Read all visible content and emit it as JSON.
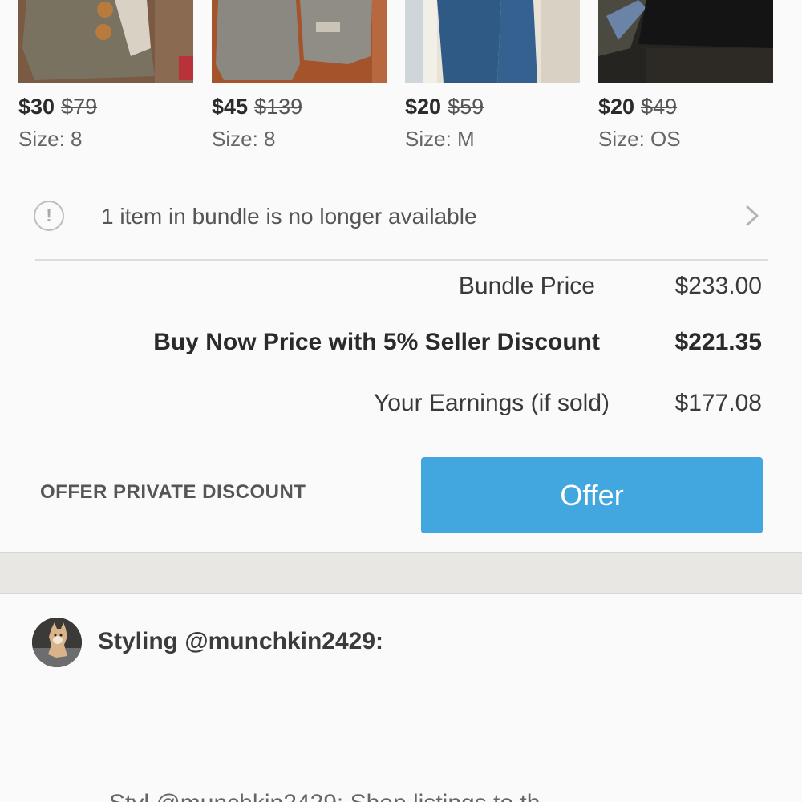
{
  "products": [
    {
      "price": "$30",
      "original_price": "$79",
      "size": "Size: 8"
    },
    {
      "price": "$45",
      "original_price": "$139",
      "size": "Size: 8"
    },
    {
      "price": "$20",
      "original_price": "$59",
      "size": "Size: M"
    },
    {
      "price": "$20",
      "original_price": "$49",
      "size": "Size: OS"
    }
  ],
  "notice": {
    "text": "1 item in bundle is no longer available",
    "icon": "alert-circle-icon",
    "chevron": "chevron-right-icon"
  },
  "summary": {
    "bundle_label": "Bundle Price",
    "bundle_value": "$233.00",
    "buy_now_label": "Buy Now Price with 5% Seller Discount",
    "buy_now_value": "$221.35",
    "earnings_label": "Your Earnings (if sold)",
    "earnings_value": "$177.08"
  },
  "actions": {
    "private_discount_label": "OFFER PRIVATE DISCOUNT",
    "offer_label": "Offer"
  },
  "styling": {
    "label": "Styling @munchkin2429:",
    "body_partial": "Styl @munchkin2429: Shop listings to th"
  },
  "colors": {
    "accent": "#43a7df",
    "background": "#fbfafa",
    "band": "#e9e7e4"
  }
}
